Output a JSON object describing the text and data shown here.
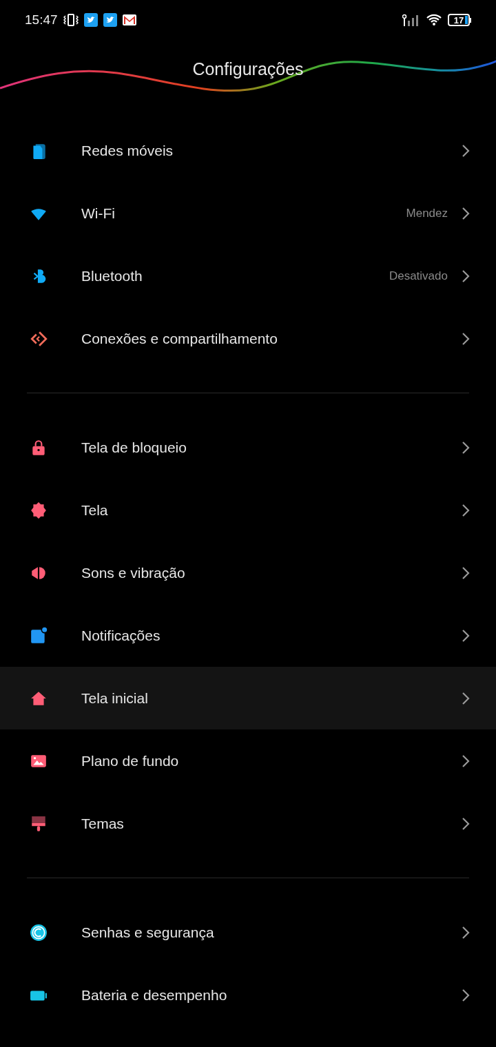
{
  "status_bar": {
    "time": "15:47",
    "battery": "17"
  },
  "header": {
    "title": "Configurações"
  },
  "sections": [
    {
      "items": [
        {
          "label": "Redes móveis",
          "selected": false
        },
        {
          "label": "Wi-Fi",
          "value": "Mendez",
          "selected": false
        },
        {
          "label": "Bluetooth",
          "value": "Desativado",
          "selected": false
        },
        {
          "label": "Conexões e compartilhamento",
          "selected": false
        }
      ]
    },
    {
      "items": [
        {
          "label": "Tela de bloqueio",
          "selected": false
        },
        {
          "label": "Tela",
          "selected": false
        },
        {
          "label": "Sons e vibração",
          "selected": false
        },
        {
          "label": "Notificações",
          "selected": false
        },
        {
          "label": "Tela inicial",
          "selected": true
        },
        {
          "label": "Plano de fundo",
          "selected": false
        },
        {
          "label": "Temas",
          "selected": false
        }
      ]
    },
    {
      "items": [
        {
          "label": "Senhas e segurança",
          "selected": false
        },
        {
          "label": "Bateria e desempenho",
          "selected": false
        }
      ]
    }
  ]
}
